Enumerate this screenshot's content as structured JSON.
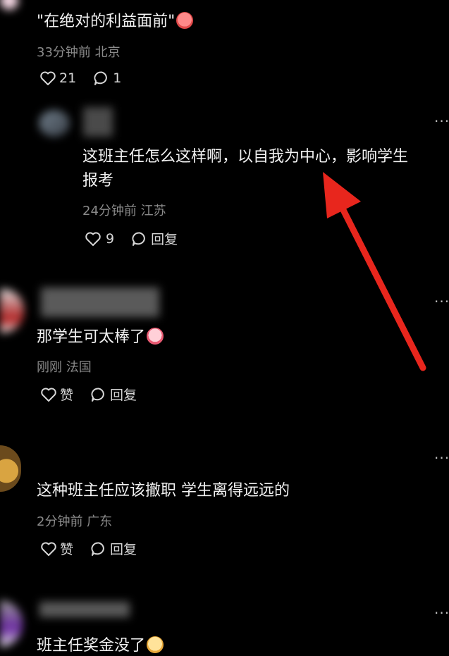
{
  "comments": [
    {
      "text": "\"在绝对的利益面前\"",
      "meta": "33分钟前 北京",
      "likes": "21",
      "replies": "1"
    },
    {
      "text_line1": "这班主任怎么这样啊，以自我为中心，影响学生",
      "text_line2": "报考",
      "meta": "24分钟前 江苏",
      "likes": "9",
      "reply_label": "回复"
    },
    {
      "text": "那学生可太棒了",
      "meta": "刚刚 法国",
      "like_label": "赞",
      "reply_label": "回复"
    },
    {
      "text": "这种班主任应该撤职 学生离得远远的",
      "meta": "2分钟前 广东",
      "like_label": "赞",
      "reply_label": "回复"
    },
    {
      "text": "班主任奖金没了"
    }
  ],
  "more_glyph": "···",
  "colors": {
    "background": "#000000",
    "text": "#f2f2f2",
    "meta": "#8a8a8a",
    "arrow": "#e8261d"
  },
  "icons": [
    "heart-icon",
    "comment-icon",
    "more-icon"
  ]
}
